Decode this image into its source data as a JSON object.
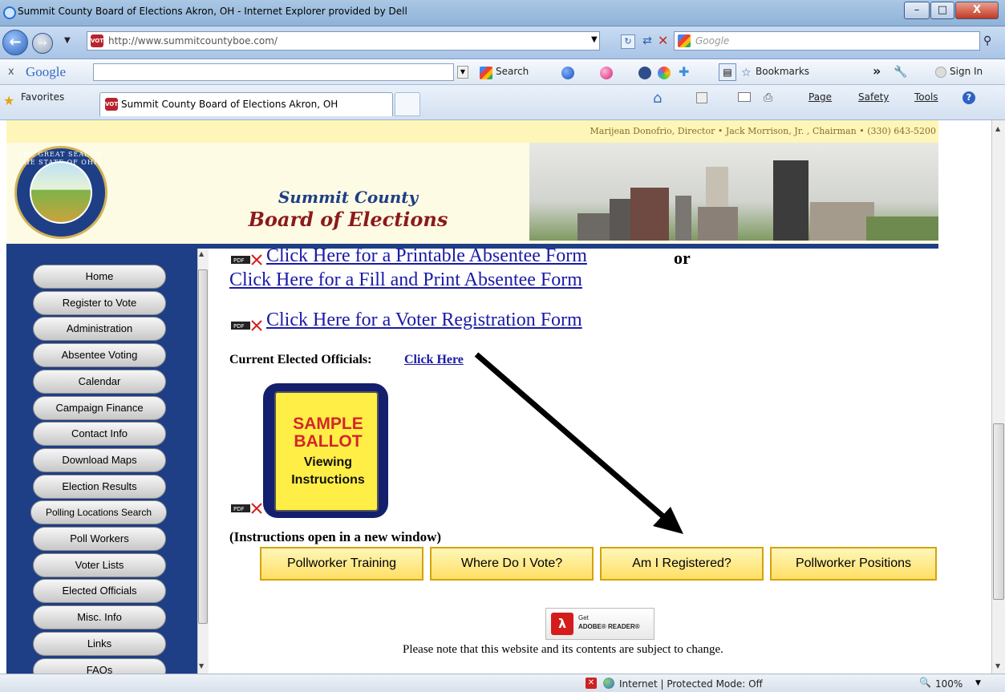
{
  "window": {
    "title": "Summit County Board of Elections Akron, OH - Internet Explorer provided by Dell",
    "minimize": "–",
    "maximize": "□",
    "close": "X"
  },
  "navbar": {
    "url_domain": "http://www.summitcountyboe.com/",
    "search_placeholder": "Google"
  },
  "google_toolbar": {
    "close": "x",
    "brand": "Google",
    "search_label": "Search",
    "bookmarks_label": "Bookmarks",
    "more": "»",
    "sign_in": "Sign In"
  },
  "favorites_bar": {
    "favorites_label": "Favorites",
    "tab_title": "Summit County Board of Elections Akron, OH",
    "page_menu": "Page",
    "safety_menu": "Safety",
    "tools_menu": "Tools"
  },
  "site": {
    "header_contacts": "Marijean Donofrio, Director • Jack Morrison, Jr. , Chairman • (330) 643-5200",
    "seal_text": "THE GREAT SEAL OF THE STATE OF OHIO",
    "brand_line1": "Summit County",
    "brand_line2": "Board of Elections",
    "favicon_text": "VOTE"
  },
  "sidebar": {
    "items": [
      {
        "label": "Home"
      },
      {
        "label": "Register to Vote"
      },
      {
        "label": "Administration"
      },
      {
        "label": "Absentee Voting"
      },
      {
        "label": "Calendar"
      },
      {
        "label": "Campaign Finance"
      },
      {
        "label": "Contact Info"
      },
      {
        "label": "Download Maps"
      },
      {
        "label": "Election Results"
      },
      {
        "label": "Polling Locations Search"
      },
      {
        "label": "Poll Workers"
      },
      {
        "label": "Voter Lists"
      },
      {
        "label": "Elected Officials"
      },
      {
        "label": "Misc. Info"
      },
      {
        "label": "Links"
      },
      {
        "label": "FAQs"
      }
    ]
  },
  "content": {
    "printable_absentee": "Click Here for a Printable Absentee Form",
    "or_text": "or",
    "fill_print_absentee": "Click Here for a Fill and Print Absentee Form",
    "voter_registration": "Click Here for a Voter Registration Form",
    "officials_label": "Current Elected Officials:",
    "officials_link": "Click Here",
    "sample_ballot": {
      "line1": "SAMPLE",
      "line2": "BALLOT",
      "line3": "Viewing",
      "line4": "Instructions"
    },
    "pdf_badge": "PDF",
    "instructions_note": "(Instructions open in a new window)",
    "buttons": [
      {
        "label": "Pollworker Training"
      },
      {
        "label": "Where Do I Vote?"
      },
      {
        "label": "Am I Registered?"
      },
      {
        "label": "Pollworker Positions"
      }
    ],
    "adobe_get": "Get",
    "adobe_reader": "ADOBE® READER®",
    "disclaimer": "Please note that this website and its contents are subject to change."
  },
  "statusbar": {
    "status": "Internet | Protected Mode: Off",
    "zoom": "100%"
  },
  "colors": {
    "sidebar_blue": "#1e3f86",
    "link_blue": "#1a1aa6",
    "button_gold": "#ffdf64"
  }
}
